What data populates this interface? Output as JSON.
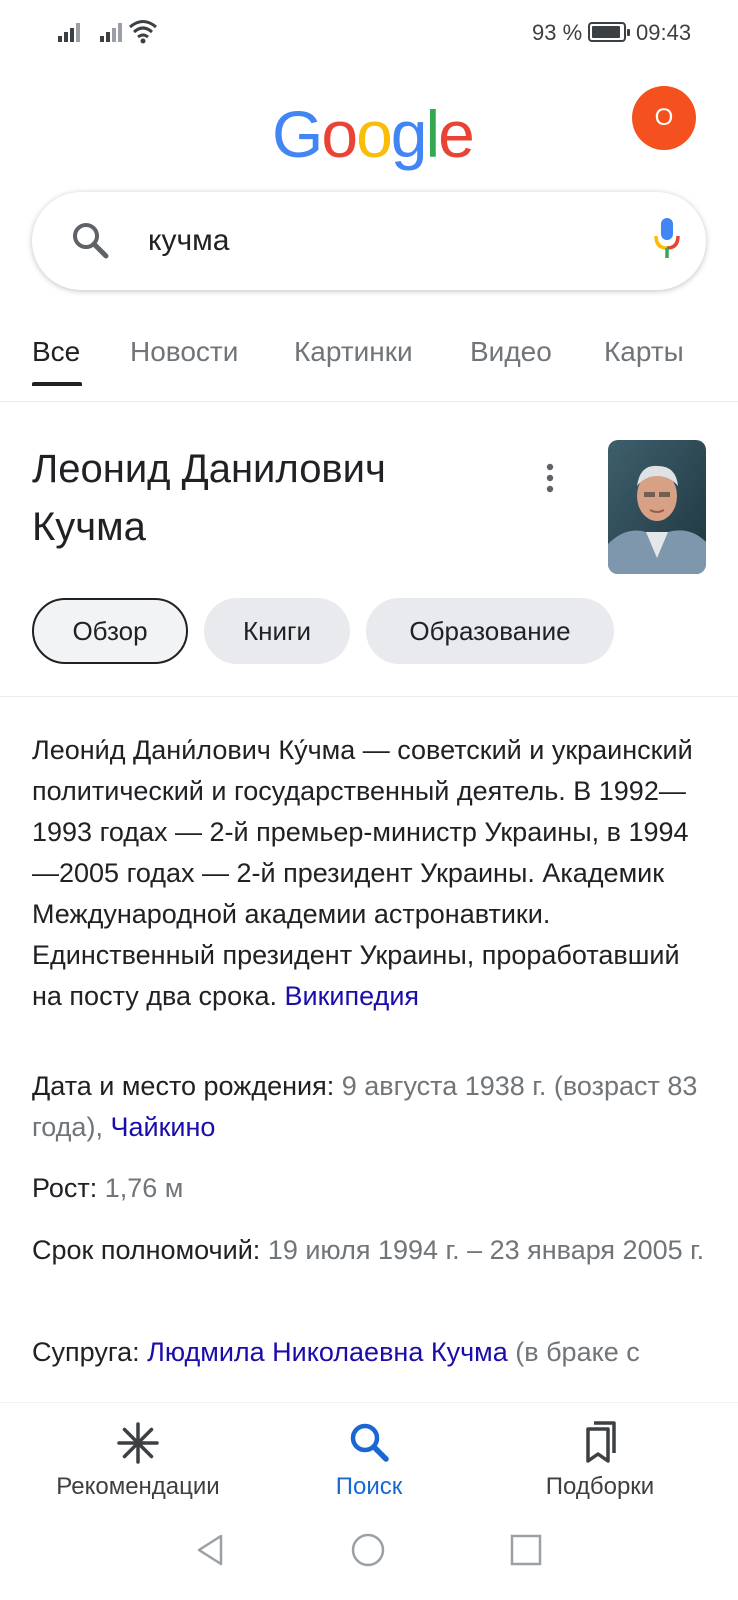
{
  "status_bar": {
    "battery_percent": "93 %",
    "battery_level": 0.93,
    "time": "09:43"
  },
  "header": {
    "logo_letters": [
      "G",
      "o",
      "o",
      "g",
      "l",
      "e"
    ],
    "avatar_letter": "О"
  },
  "search": {
    "query": "кучма"
  },
  "tabs": [
    {
      "label": "Все",
      "active": true
    },
    {
      "label": "Новости",
      "active": false
    },
    {
      "label": "Картинки",
      "active": false
    },
    {
      "label": "Видео",
      "active": false
    },
    {
      "label": "Карты",
      "active": false
    }
  ],
  "entity": {
    "title_line1": "Леонид Данилович",
    "title_line2": "Кучма",
    "chips": [
      {
        "label": "Обзор",
        "selected": true
      },
      {
        "label": "Книги",
        "selected": false
      },
      {
        "label": "Образование",
        "selected": false
      }
    ],
    "description": "Леони́д Дани́лович Ку́чма — советский и украинский политический и государственный деятель. В 1992—1993 годах — 2-й премьер-министр Украины, в 1994—2005 годах — 2-й президент Украины. Академик Международной академии астронавтики. Единственный президент Украины, проработавший на посту два срока.",
    "source_link": "Википедия",
    "facts": {
      "birth": {
        "label": "Дата и место рождения:",
        "value": "9 августа 1938 г. (возраст 83 года),",
        "link": "Чайкино"
      },
      "height": {
        "label": "Рост:",
        "value": "1,76 м"
      },
      "term": {
        "label": "Срок полномочий:",
        "value": "19 июля 1994 г. – 23 января 2005 г."
      },
      "spouse": {
        "label": "Супруга:",
        "link": "Людмила Николаевна Кучма",
        "value": "(в браке с"
      }
    }
  },
  "bottom_nav": [
    {
      "label": "Рекомендации",
      "active": false
    },
    {
      "label": "Поиск",
      "active": true
    },
    {
      "label": "Подборки",
      "active": false
    }
  ],
  "colors": {
    "google_blue": "#4285f4",
    "google_red": "#ea4335",
    "google_yellow": "#fbbc05",
    "google_green": "#34a853",
    "link": "#1a0dab",
    "active_nav": "#1967d2",
    "avatar": "#f4511e"
  }
}
